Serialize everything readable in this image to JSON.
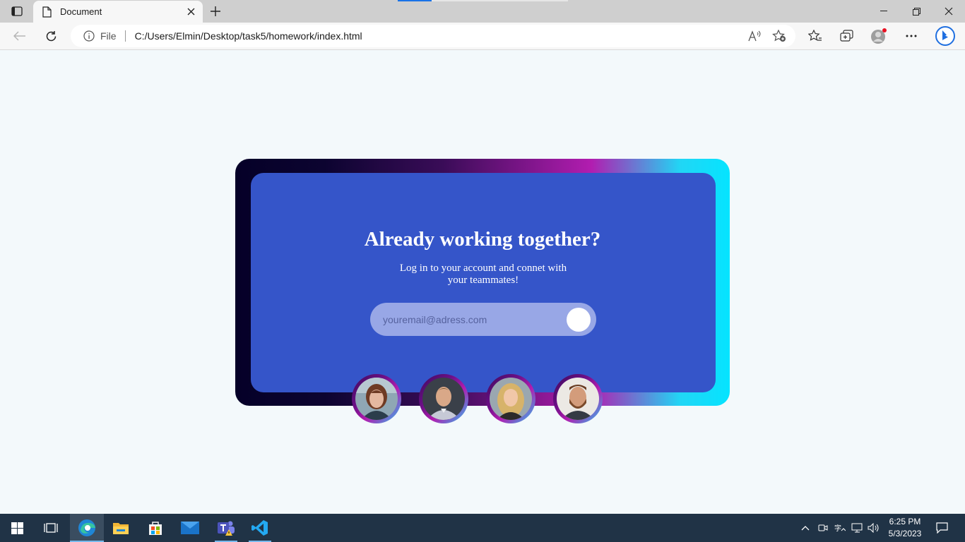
{
  "browser": {
    "tab_title": "Document",
    "address_scheme": "File",
    "address_url": "C:/Users/Elmin/Desktop/task5/homework/index.html"
  },
  "page": {
    "title": "Already working together?",
    "subtitle": "Log in to your account and connet with your teammates!",
    "email_placeholder": "youremail@adress.com",
    "colors": {
      "background": "#f3f9fb",
      "card": "#3555c9",
      "input": "#98a7e6",
      "gradient_dark": "#050028",
      "gradient_magenta": "#b21db0",
      "gradient_cyan": "#05e4ff"
    }
  },
  "taskbar": {
    "apps": [
      "start-icon",
      "task-view-icon",
      "edge-icon",
      "file-explorer-icon",
      "store-icon",
      "mail-icon",
      "teams-icon",
      "vscode-icon"
    ],
    "time": "6:25 PM",
    "date": "5/3/2023"
  }
}
